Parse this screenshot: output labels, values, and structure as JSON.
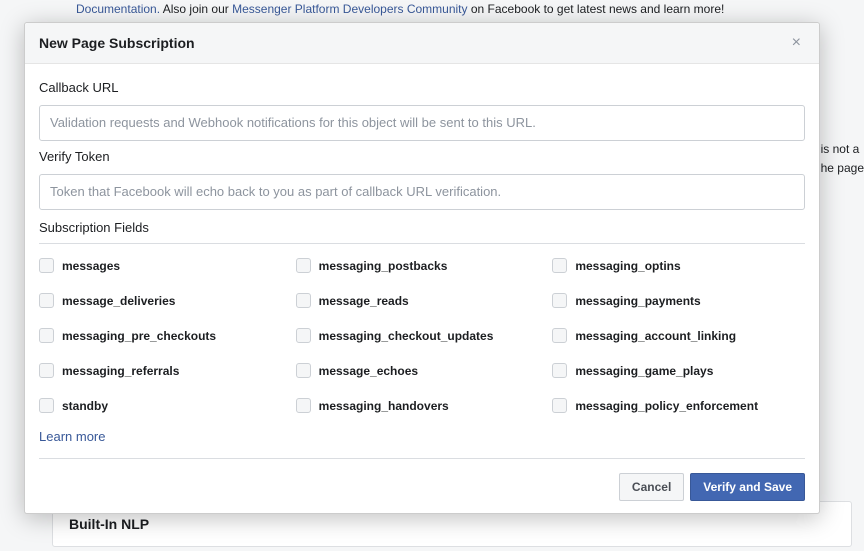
{
  "background": {
    "text_prefix": "Also join our ",
    "doc_link_label": "Documentation.",
    "community_link_label": "Messenger Platform Developers Community",
    "text_suffix": " on Facebook to get latest news and learn more!",
    "side_snippet_1": "is not a",
    "side_snippet_2": "he page",
    "nlp_box_label": "Built-In NLP"
  },
  "modal": {
    "title": "New Page Subscription",
    "close_glyph": "×",
    "callback_label": "Callback URL",
    "callback_placeholder": "Validation requests and Webhook notifications for this object will be sent to this URL.",
    "verify_label": "Verify Token",
    "verify_placeholder": "Token that Facebook will echo back to you as part of callback URL verification.",
    "fields_label": "Subscription Fields",
    "fields": [
      "messages",
      "messaging_postbacks",
      "messaging_optins",
      "message_deliveries",
      "message_reads",
      "messaging_payments",
      "messaging_pre_checkouts",
      "messaging_checkout_updates",
      "messaging_account_linking",
      "messaging_referrals",
      "message_echoes",
      "messaging_game_plays",
      "standby",
      "messaging_handovers",
      "messaging_policy_enforcement"
    ],
    "learn_more_label": "Learn more",
    "cancel_label": "Cancel",
    "save_label": "Verify and Save"
  }
}
